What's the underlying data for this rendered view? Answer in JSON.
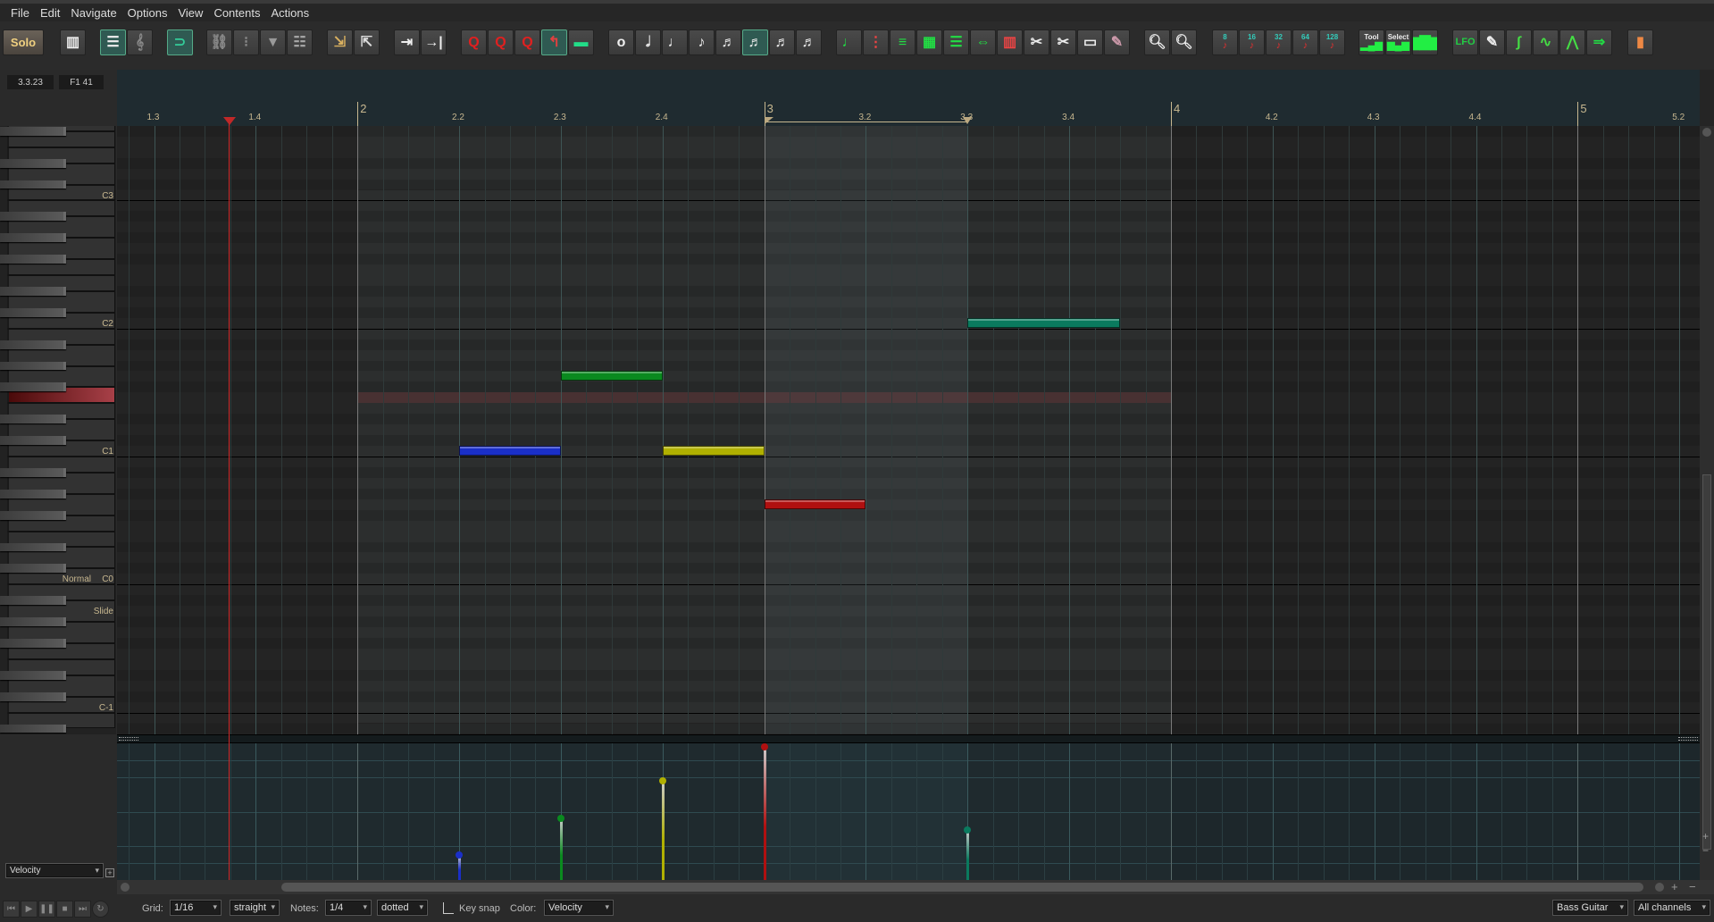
{
  "menu": [
    "File",
    "Edit",
    "Navigate",
    "Options",
    "View",
    "Contents",
    "Actions"
  ],
  "toolbar": {
    "groups": [
      [
        {
          "icon": "solo",
          "label": "Solo"
        }
      ],
      [
        {
          "icon": "piano-roll"
        }
      ],
      [
        {
          "icon": "named-notes",
          "active": true
        },
        {
          "icon": "notation-clef"
        }
      ],
      [
        {
          "icon": "loop-source",
          "active": true
        }
      ],
      [
        {
          "icon": "link"
        },
        {
          "icon": "footsteps"
        },
        {
          "icon": "filter"
        },
        {
          "icon": "event-list"
        }
      ],
      [
        {
          "icon": "import-item"
        },
        {
          "icon": "export-item"
        }
      ],
      [
        {
          "icon": "move-cursor-right"
        },
        {
          "icon": "cursor-to-end"
        }
      ],
      [
        {
          "icon": "quantize"
        },
        {
          "icon": "quantize-groove"
        },
        {
          "icon": "quantize-settings"
        },
        {
          "icon": "unquantize",
          "active": true
        },
        {
          "icon": "stretch"
        }
      ],
      [
        {
          "icon": "whole-note"
        },
        {
          "icon": "half-note"
        },
        {
          "icon": "quarter-note"
        },
        {
          "icon": "eighth-note"
        },
        {
          "icon": "sixteenth-triplet"
        },
        {
          "icon": "sixteenth-note",
          "active": true
        },
        {
          "icon": "thirtysecond-triplet"
        },
        {
          "icon": "thirtysecond-note"
        }
      ],
      [
        {
          "icon": "legato"
        },
        {
          "icon": "select-notes"
        },
        {
          "icon": "arrange-notes"
        },
        {
          "icon": "grid-notes"
        },
        {
          "icon": "stack-notes"
        },
        {
          "icon": "fit-notes"
        },
        {
          "icon": "drum-edit"
        },
        {
          "icon": "cut-red"
        },
        {
          "icon": "cut-green"
        },
        {
          "icon": "razor"
        },
        {
          "icon": "eraser"
        }
      ],
      [
        {
          "icon": "zoom-horizontal"
        },
        {
          "icon": "zoom-auto"
        }
      ],
      [
        {
          "icon": "delete-short-notes",
          "label": "8"
        },
        {
          "icon": "delete-short-notes",
          "label": "16"
        },
        {
          "icon": "delete-short-notes",
          "label": "32"
        },
        {
          "icon": "delete-short-notes",
          "label": "64"
        },
        {
          "icon": "delete-short-notes",
          "label": "128"
        }
      ],
      [
        {
          "icon": "velocity-tool",
          "label": "Tool"
        },
        {
          "icon": "velocity-select",
          "label": "Select"
        },
        {
          "icon": "velocity-bars"
        }
      ],
      [
        {
          "icon": "lfo",
          "label": "LFO"
        },
        {
          "icon": "mouse-pencil"
        },
        {
          "icon": "curve-pencil"
        },
        {
          "icon": "sine-pencil"
        },
        {
          "icon": "ramp-pencil"
        },
        {
          "icon": "route"
        }
      ],
      [
        {
          "icon": "color-map"
        }
      ]
    ]
  },
  "position": {
    "time": "3.3.23",
    "pitch": "F1  41"
  },
  "ruler": {
    "bars": [
      "2",
      "3",
      "4",
      "5"
    ],
    "beats": [
      "1.3",
      "1.4",
      "2.2",
      "2.3",
      "2.4",
      "3.2",
      "3.3",
      "3.4",
      "4.2",
      "4.3",
      "4.4",
      "5.2"
    ]
  },
  "piano": {
    "octave_labels": [
      {
        "pitch": 60,
        "text": "C3"
      },
      {
        "pitch": 48,
        "text": "C2"
      },
      {
        "pitch": 36,
        "text": "C1"
      },
      {
        "pitch": 24,
        "text": "C0"
      },
      {
        "pitch": 12,
        "text": "C-1"
      }
    ],
    "articulation_labels": [
      {
        "pitch": 24,
        "text": "Normal"
      },
      {
        "pitch": 21,
        "text": "Slide"
      }
    ],
    "highlight_pitch": 41,
    "highlight_color": "#9a3a40"
  },
  "notes": [
    {
      "start": "2.2",
      "beats": 1,
      "pitch": 36,
      "name": "C1",
      "velocity": 24,
      "color": "#1a2fc8"
    },
    {
      "start": "2.3",
      "beats": 1,
      "pitch": 43,
      "name": "G1",
      "velocity": 59,
      "color": "#0a8a1f"
    },
    {
      "start": "2.4",
      "beats": 1,
      "pitch": 36,
      "name": "C1",
      "velocity": 95,
      "color": "#b0b000"
    },
    {
      "start": "3.1",
      "beats": 1,
      "pitch": 31,
      "name": "G0",
      "velocity": 127,
      "color": "#b01010"
    },
    {
      "start": "3.3",
      "beats": 1.5,
      "pitch": 48,
      "name": "C2",
      "velocity": 48,
      "color": "#0a7a5e"
    }
  ],
  "item": {
    "start": "2.1",
    "end": "4.1"
  },
  "time_selection": {
    "start": "3.1",
    "end": "3.3"
  },
  "cc_lane": {
    "selected": "Velocity",
    "add_label": "+"
  },
  "bottom": {
    "grid_label": "Grid:",
    "grid_value": "1/16",
    "grid_type": "straight",
    "notes_label": "Notes:",
    "notes_value": "1/4",
    "notes_type": "dotted",
    "key_snap_label": "Key snap",
    "key_snap_checked": false,
    "color_label": "Color:",
    "color_value": "Velocity",
    "track": "Bass Guitar",
    "channels": "All channels"
  }
}
